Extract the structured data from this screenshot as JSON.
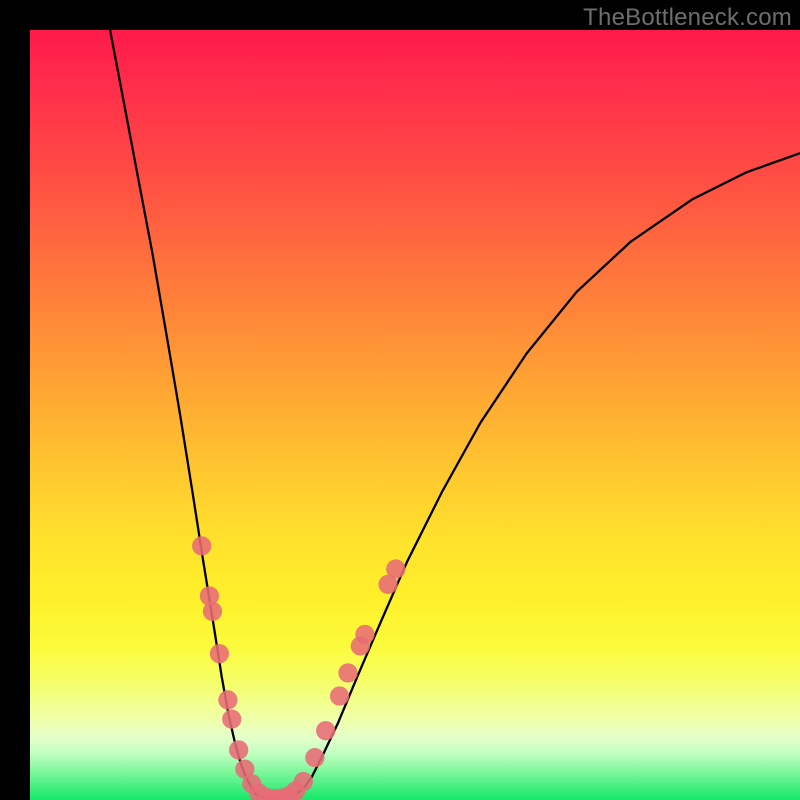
{
  "watermark": "TheBottleneck.com",
  "chart_data": {
    "type": "line",
    "title": "",
    "xlabel": "",
    "ylabel": "",
    "xlim": [
      0,
      100
    ],
    "ylim": [
      0,
      100
    ],
    "series": [
      {
        "name": "left-branch",
        "x": [
          10.4,
          12.3,
          14.0,
          15.9,
          17.8,
          19.5,
          21.1,
          22.5,
          23.8,
          24.9,
          25.8,
          26.6,
          27.3,
          27.9,
          28.5,
          29.1,
          29.4
        ],
        "y": [
          100,
          90.0,
          81.0,
          71.0,
          60.0,
          50.0,
          40.0,
          31.0,
          23.0,
          16.0,
          11.0,
          7.5,
          5.0,
          3.3,
          2.1,
          1.1,
          0.7
        ]
      },
      {
        "name": "valley-floor",
        "x": [
          29.4,
          30.2,
          31.1,
          32.0,
          33.0,
          33.9,
          34.5
        ],
        "y": [
          0.7,
          0.32,
          0.18,
          0.13,
          0.18,
          0.33,
          0.7
        ]
      },
      {
        "name": "right-branch",
        "x": [
          34.5,
          35.5,
          36.6,
          38.1,
          40.0,
          42.5,
          45.5,
          49.0,
          53.5,
          58.5,
          64.5,
          71.0,
          78.0,
          86.0,
          93.0,
          100.0
        ],
        "y": [
          0.7,
          1.5,
          3.0,
          6.0,
          10.0,
          16.0,
          23.0,
          31.0,
          40.0,
          49.0,
          58.0,
          66.0,
          72.5,
          78.0,
          81.5,
          84.0
        ]
      }
    ],
    "dots": [
      {
        "x": 22.3,
        "y": 33.0
      },
      {
        "x": 23.3,
        "y": 26.5
      },
      {
        "x": 23.7,
        "y": 24.5
      },
      {
        "x": 24.6,
        "y": 19.0
      },
      {
        "x": 25.7,
        "y": 13.0
      },
      {
        "x": 26.2,
        "y": 10.5
      },
      {
        "x": 27.1,
        "y": 6.5
      },
      {
        "x": 27.9,
        "y": 4.0
      },
      {
        "x": 28.8,
        "y": 2.1
      },
      {
        "x": 29.7,
        "y": 0.9
      },
      {
        "x": 30.6,
        "y": 0.35
      },
      {
        "x": 31.6,
        "y": 0.2
      },
      {
        "x": 32.6,
        "y": 0.25
      },
      {
        "x": 33.6,
        "y": 0.55
      },
      {
        "x": 34.5,
        "y": 1.2
      },
      {
        "x": 35.5,
        "y": 2.4
      },
      {
        "x": 37.0,
        "y": 5.5
      },
      {
        "x": 38.4,
        "y": 9.0
      },
      {
        "x": 40.2,
        "y": 13.5
      },
      {
        "x": 41.3,
        "y": 16.5
      },
      {
        "x": 42.9,
        "y": 20.0
      },
      {
        "x": 43.5,
        "y": 21.5
      },
      {
        "x": 46.5,
        "y": 28.0
      },
      {
        "x": 47.5,
        "y": 30.0
      }
    ],
    "dot_radius_pct": 1.25,
    "gradient_stops": [
      {
        "pos": 0.0,
        "color": "#ff1a4b"
      },
      {
        "pos": 0.38,
        "color": "#ff8a38"
      },
      {
        "pos": 0.66,
        "color": "#ffe12c"
      },
      {
        "pos": 0.87,
        "color": "#f2ff88"
      },
      {
        "pos": 0.96,
        "color": "#88f8a0"
      },
      {
        "pos": 1.0,
        "color": "#14e868"
      }
    ]
  }
}
